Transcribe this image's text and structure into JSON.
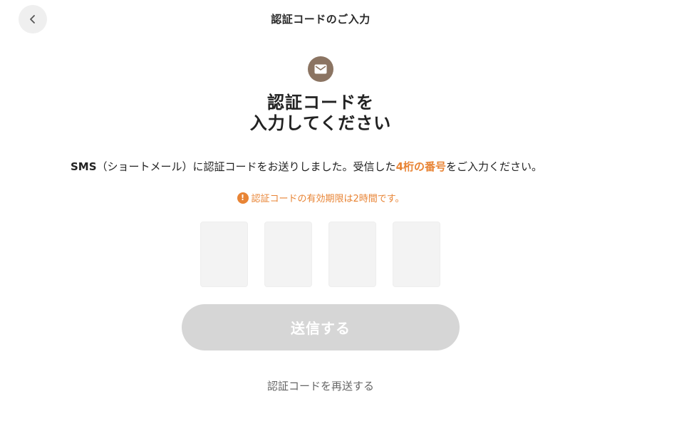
{
  "header": {
    "title": "認証コードのご入力",
    "back_icon": "chevron-left-icon"
  },
  "mail_icon": "envelope-icon",
  "heading": {
    "line1": "認証コードを",
    "line2": "入力してください"
  },
  "instruction": {
    "sms": "SMS",
    "before": "（ショートメール）に認証コードをお送りしました。受信した",
    "emphasis": "4桁の番号",
    "after": "をご入力ください。"
  },
  "notice": {
    "icon": "!",
    "text": "認証コードの有効期限は2時間です。"
  },
  "code_inputs": [
    "",
    "",
    "",
    ""
  ],
  "submit": {
    "label": "送信する"
  },
  "resend": {
    "label": "認証コードを再送する"
  },
  "colors": {
    "accent": "#e88435",
    "badge": "#8b7462",
    "button_disabled": "#d6d6d6",
    "input_bg": "#f3f3f3"
  }
}
